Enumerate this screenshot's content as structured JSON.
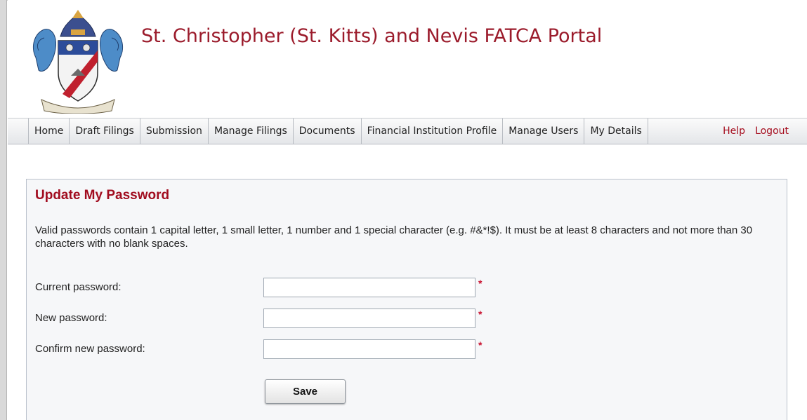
{
  "header": {
    "title": "St. Christopher (St. Kitts) and Nevis FATCA Portal"
  },
  "nav": {
    "items": [
      {
        "label": "Home"
      },
      {
        "label": "Draft Filings"
      },
      {
        "label": "Submission"
      },
      {
        "label": "Manage Filings"
      },
      {
        "label": "Documents"
      },
      {
        "label": "Financial Institution Profile"
      },
      {
        "label": "Manage Users"
      },
      {
        "label": "My Details"
      }
    ],
    "help_label": "Help",
    "logout_label": "Logout"
  },
  "panel": {
    "title": "Update My Password",
    "description": "Valid passwords contain 1 capital letter, 1 small letter, 1 number and 1 special character (e.g. #&*!$). It must be at least 8 characters and not more than 30 characters with no blank spaces."
  },
  "form": {
    "current_label": "Current password:",
    "current_value": "",
    "new_label": "New password:",
    "new_value": "",
    "confirm_label": "Confirm new password:",
    "confirm_value": "",
    "required_marker": "*",
    "save_label": "Save"
  },
  "colors": {
    "brand_red": "#9b1b2b",
    "required_red": "#c8102e",
    "panel_border": "#b9c1cb"
  },
  "icons": {
    "logo": "coat-of-arms-logo"
  }
}
